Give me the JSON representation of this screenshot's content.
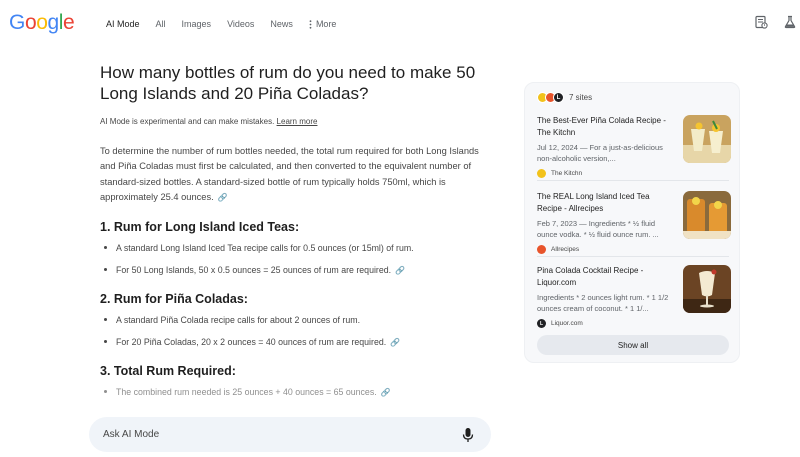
{
  "header": {
    "logo_letters": [
      {
        "ch": "G",
        "color": "#4285F4"
      },
      {
        "ch": "o",
        "color": "#EA4335"
      },
      {
        "ch": "o",
        "color": "#FBBC05"
      },
      {
        "ch": "g",
        "color": "#4285F4"
      },
      {
        "ch": "l",
        "color": "#34A853"
      },
      {
        "ch": "e",
        "color": "#EA4335"
      }
    ],
    "tabs": [
      {
        "label": "AI Mode",
        "active": true
      },
      {
        "label": "All"
      },
      {
        "label": "Images"
      },
      {
        "label": "Videos"
      },
      {
        "label": "News"
      }
    ],
    "more_label": "More",
    "right_icons": [
      "history-icon",
      "labs-flask-icon"
    ]
  },
  "answer": {
    "question": "How many bottles of rum do you need to make 50 Long Islands and 20 Piña Coladas?",
    "disclaimer": "AI Mode is experimental and can make mistakes.",
    "learn_more": "Learn more",
    "intro": "To determine the number of rum bottles needed, the total rum required for both Long Islands and Piña Coladas must first be calculated, and then converted to the equivalent number of standard-sized bottles. A standard-sized bottle of rum typically holds 750ml, which is approximately 25.4 ounces.",
    "sections": [
      {
        "heading": "1. Rum for Long Island Iced Teas:",
        "bullets": [
          {
            "text": "A standard Long Island Iced Tea recipe calls for 0.5 ounces (or 15ml) of rum.",
            "link": false
          },
          {
            "text": "For 50 Long Islands, 50 x 0.5 ounces = 25 ounces of rum are required.",
            "link": true
          }
        ]
      },
      {
        "heading": "2. Rum for Piña Coladas:",
        "bullets": [
          {
            "text": "A standard Piña Colada recipe calls for about 2 ounces of rum.",
            "link": false
          },
          {
            "text": "For 20 Piña Coladas, 20 x 2 ounces = 40 ounces of rum are required.",
            "link": true
          }
        ]
      },
      {
        "heading": "3. Total Rum Required:",
        "bullets": [
          {
            "text": "The combined rum needed is 25 ounces + 40 ounces = 65 ounces.",
            "link": true,
            "faded": true
          }
        ]
      }
    ]
  },
  "askbar": {
    "placeholder": "Ask AI Mode"
  },
  "sources": {
    "count_label": "7 sites",
    "favicon_colors": [
      "#f2c21b",
      "#e8542b",
      "#202124"
    ],
    "items": [
      {
        "title": "The Best-Ever Piña Colada Recipe - The Kitchn",
        "snippet": "Jul 12, 2024 — For a just-as-delicious non-alcoholic version,...",
        "site": "The Kitchn",
        "site_color": "#f2c21b"
      },
      {
        "title": "The REAL Long Island Iced Tea Recipe - Allrecipes",
        "snippet": "Feb 7, 2023 — Ingredients * ½ fluid ounce vodka. * ½ fluid ounce rum. ...",
        "site": "Allrecipes",
        "site_color": "#e8542b"
      },
      {
        "title": "Pina Colada Cocktail Recipe - Liquor.com",
        "snippet": "Ingredients * 2 ounces light rum. * 1 1/2 ounces cream of coconut. * 1 1/...",
        "site": "Liquor.com",
        "site_color": "#202124"
      }
    ],
    "show_all": "Show all"
  }
}
